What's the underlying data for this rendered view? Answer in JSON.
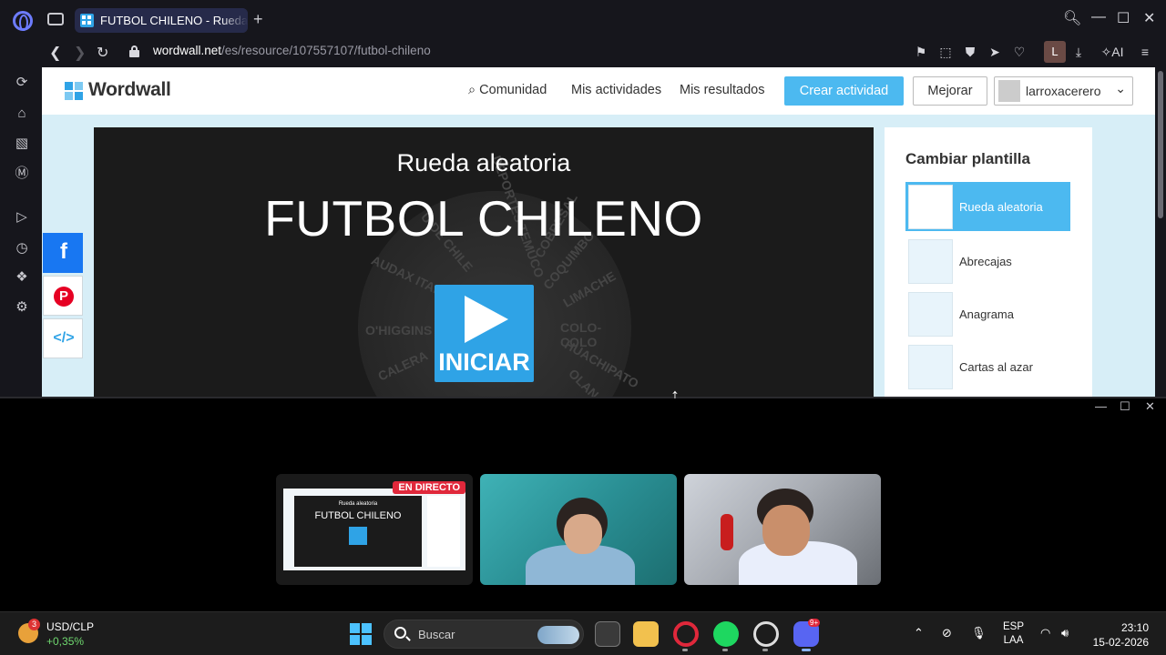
{
  "browser": {
    "tab_title": "FUTBOL CHILENO - Rueda",
    "url_host": "wordwall.net",
    "url_path": "/es/resource/107557107/futbol-chileno",
    "profile_initial": "L",
    "ai_label": "AI"
  },
  "site": {
    "logo": "Wordwall",
    "nav": {
      "comunidad": "Comunidad",
      "mis_actividades": "Mis actividades",
      "mis_resultados": "Mis resultados"
    },
    "crear_button": "Crear actividad",
    "mejorar_button": "Mejorar",
    "username": "larroxacerero",
    "brand_color": "#4cb9f0"
  },
  "game": {
    "subtitle": "Rueda aleatoria",
    "title": "FUTBOL CHILENO",
    "play_label": "INICIAR",
    "wheel_labels": [
      "DEPORTES TEMUCO",
      "HUACHIPATO",
      "COBRESAL",
      "COQUIMBO",
      "LIMACHE",
      "COLO-COLO",
      "AUDAX ITALIANO",
      "O'HIGGINS",
      "CALERA",
      "UNIÓN",
      "U DE CHILE",
      "HUACHIPATO",
      "OLAN"
    ]
  },
  "share": {
    "facebook": "f",
    "pinterest": "P",
    "embed": "</>"
  },
  "templates": {
    "title": "Cambiar plantilla",
    "items": [
      {
        "label": "Rueda aleatoria",
        "active": true
      },
      {
        "label": "Abrecajas",
        "active": false
      },
      {
        "label": "Anagrama",
        "active": false
      },
      {
        "label": "Cartas al azar",
        "active": false
      }
    ]
  },
  "stream": {
    "live_badge": "EN DIRECTO",
    "mini_subtitle": "Rueda aleatoria",
    "mini_title": "FUTBOL CHILENO",
    "mini_play": "INICIAR"
  },
  "taskbar": {
    "ticker_name": "USD/CLP",
    "ticker_change": "+0,35%",
    "weather_badge": "3",
    "search_placeholder": "Buscar",
    "discord_badge": "9+",
    "lang_top": "ESP",
    "lang_bottom": "LAA",
    "time": "23:10",
    "date": "15-02-2026"
  }
}
